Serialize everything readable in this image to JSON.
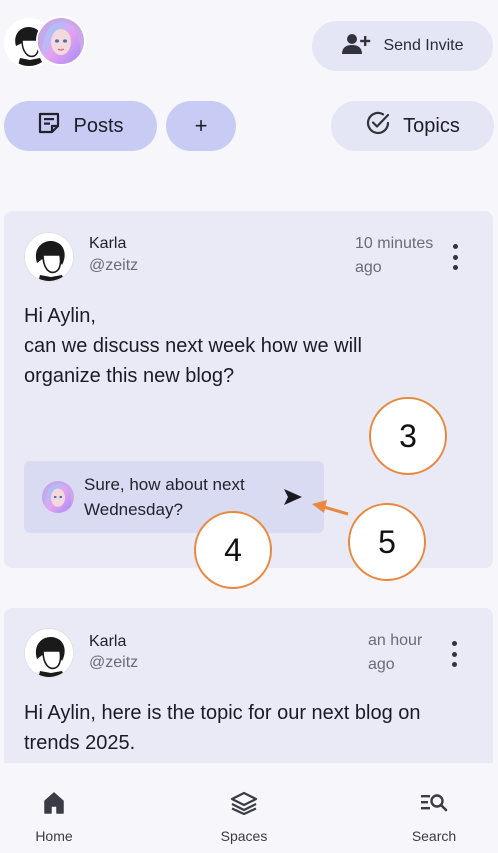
{
  "header": {
    "invite_label": "Send Invite"
  },
  "filters": {
    "posts_label": "Posts",
    "add_label": "+",
    "topics_label": "Topics"
  },
  "posts": [
    {
      "author": "Karla",
      "handle": "@zeitz",
      "time_line1": "10 minutes",
      "time_line2": "ago",
      "text_lines": [
        "Hi Aylin,",
        "can we discuss next week how we will",
        "organize this new blog?"
      ],
      "reply": {
        "line1": "Sure, how about next",
        "line2": "Wednesday?"
      }
    },
    {
      "author": "Karla",
      "handle": "@zeitz",
      "time_line1": "an hour",
      "time_line2": "ago",
      "text_lines": [
        "Hi Aylin, here is the topic for our next blog on",
        "trends 2025."
      ]
    }
  ],
  "annotations": {
    "step3": "3",
    "step4": "4",
    "step5": "5"
  },
  "nav": {
    "home": "Home",
    "spaces": "Spaces",
    "search": "Search"
  },
  "colors": {
    "accent_pill": "#c8ccf4",
    "card_bg": "#e9eaf6",
    "annotation": "#e8893f"
  }
}
